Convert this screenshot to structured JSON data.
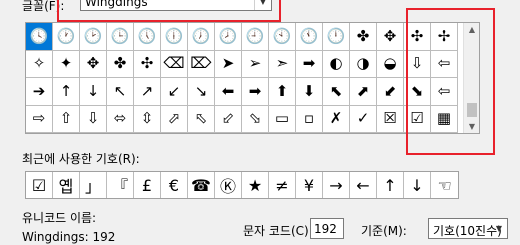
{
  "font_row": {
    "label": "글꼴(F):",
    "value": "Wingdings"
  },
  "grid": {
    "rows": [
      [
        "🕓",
        "🕐",
        "🕑",
        "🕒",
        "🕔",
        "🕕",
        "🕖",
        "🕗",
        "🕘",
        "🕙",
        "🕚",
        "🕛",
        "✤",
        "✥",
        "✣",
        "✢"
      ],
      [
        "✧",
        "✦",
        "✥",
        "✤",
        "✣",
        "⌫",
        "⌦",
        "➤",
        "➢",
        "➣",
        "➡",
        "◐",
        "◑",
        "◒",
        "⇩",
        "⇦"
      ],
      [
        "➔",
        "↑",
        "↓",
        "↖",
        "↗",
        "↙",
        "↘",
        "⬅",
        "➡",
        "⬆",
        "⬇",
        "⬉",
        "⬈",
        "⬋",
        "⬊",
        "⇦"
      ],
      [
        "⇨",
        "⇧",
        "⇩",
        "⬄",
        "⇳",
        "⬀",
        "⬁",
        "⬃",
        "⬂",
        "▭",
        "▫",
        "✗",
        "✓",
        "☒",
        "☑",
        "▦"
      ]
    ],
    "selected_index": 0
  },
  "recent": {
    "label": "최근에 사용한 기호(R):",
    "symbols": [
      "☑",
      "옙",
      "」",
      "『",
      "£",
      "€",
      "☎",
      "Ⓚ",
      "★",
      "≠",
      "¥",
      "→",
      "←",
      "↑",
      "↓",
      "☜"
    ]
  },
  "unicode_name": {
    "label": "유니코드 이름:",
    "value": "Wingdings: 192"
  },
  "char_code": {
    "label": "문자 코드(C):",
    "value": "192"
  },
  "from": {
    "label": "기준(M):",
    "value": "기호(10진수)"
  }
}
